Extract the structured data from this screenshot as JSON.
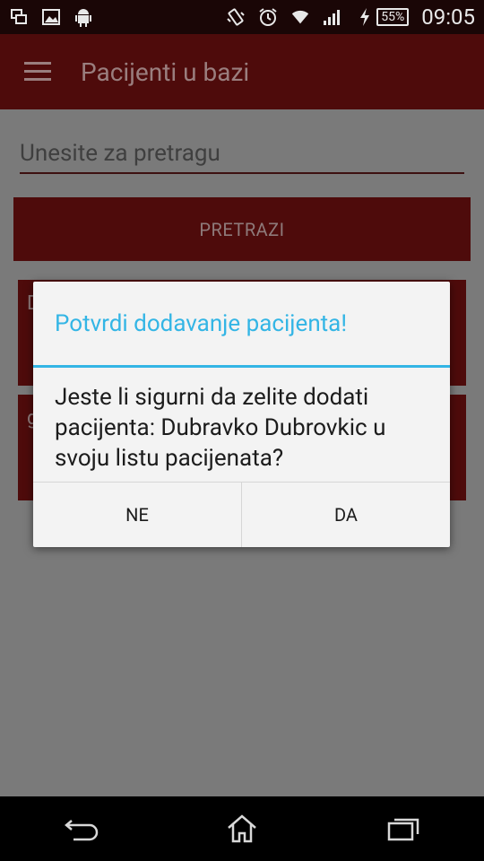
{
  "status_bar": {
    "time": "09:05",
    "battery_percent": "55%",
    "left_icons": [
      "multiwindow-icon",
      "image-icon",
      "android-icon"
    ],
    "right_icons": [
      "vibrate-icon",
      "alarm-icon",
      "wifi-icon",
      "signal-icon",
      "charging-icon"
    ]
  },
  "app_bar": {
    "title": "Pacijenti u bazi"
  },
  "search": {
    "placeholder": "Unesite za pretragu",
    "button_label": "PRETRAZI"
  },
  "results": [
    {
      "label": "D"
    },
    {
      "label": "g"
    }
  ],
  "dialog": {
    "title": "Potvrdi dodavanje pacijenta!",
    "message": "Jeste li sigurni da zelite dodati pacijenta: Dubravko Dubrovkic u svoju listu pacijenata?",
    "negative_label": "NE",
    "positive_label": "DA"
  },
  "colors": {
    "primary": "#4e0b0b",
    "accent": "#33b5e5",
    "status_bar": "#1a0606"
  }
}
